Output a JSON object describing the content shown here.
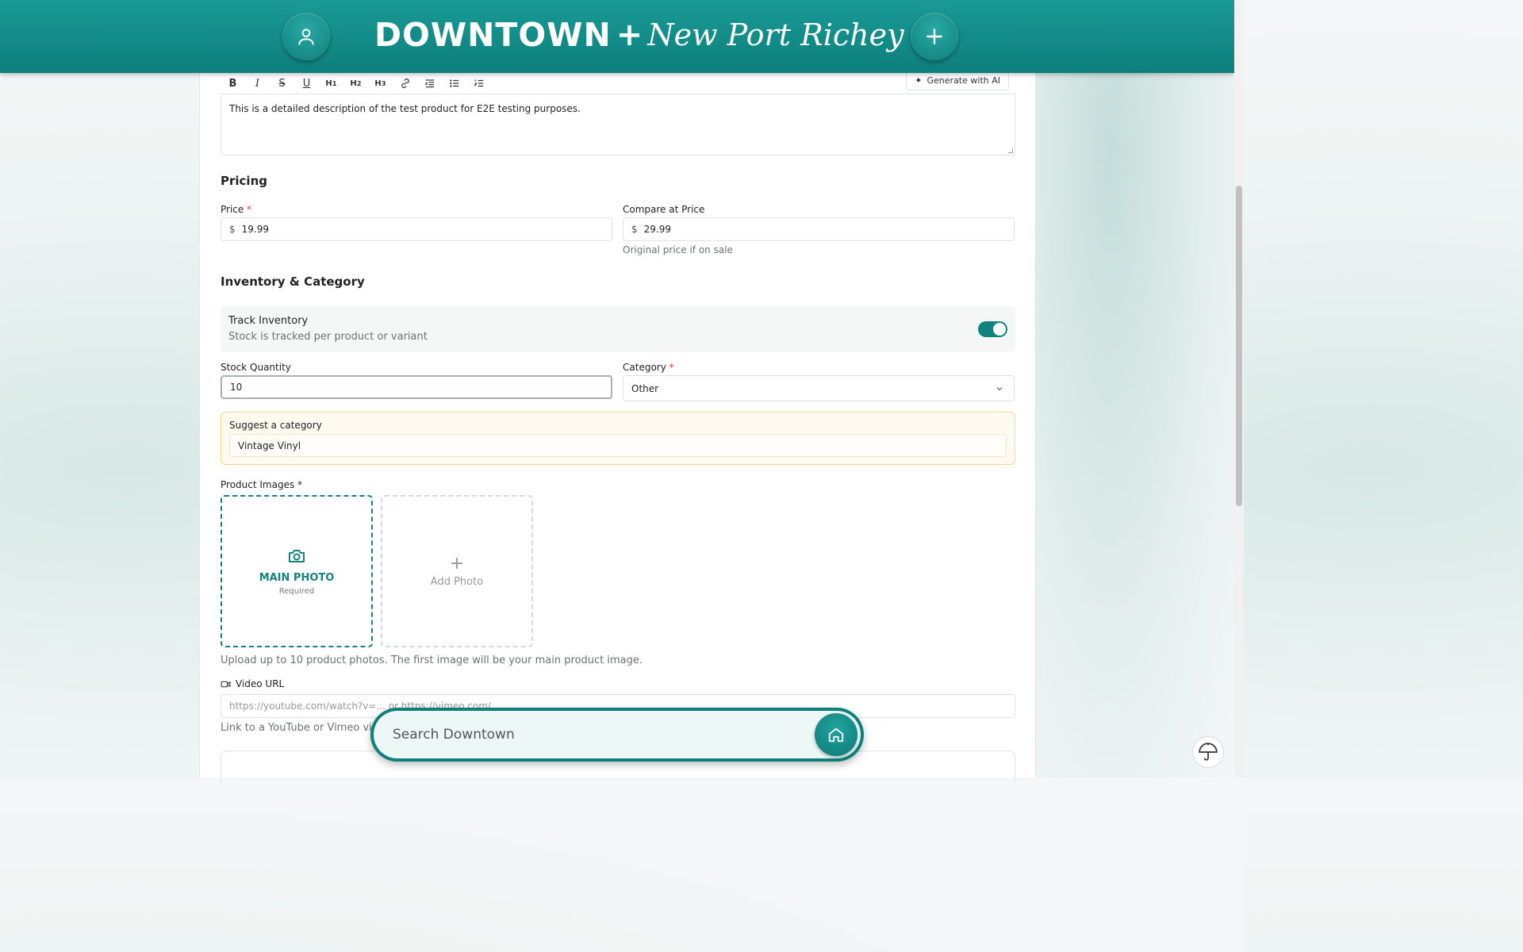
{
  "header": {
    "brand_main": "DOWNTOWN",
    "brand_plus": "+",
    "brand_sub": "New Port Richey",
    "color": "#11837f"
  },
  "editor": {
    "toolbar": [
      "B",
      "I",
      "S",
      "U",
      "H1",
      "H2",
      "H3",
      "link",
      "indent",
      "bullet-list",
      "numbered-list"
    ],
    "ai_button": "Generate with AI",
    "description": "This is a detailed description of the test product for E2E testing purposes."
  },
  "pricing": {
    "title": "Pricing",
    "price_label": "Price",
    "price_required": "*",
    "currency": "$",
    "price_value": "19.99",
    "compare_label": "Compare at Price",
    "compare_value": "29.99",
    "compare_help": "Original price if on sale"
  },
  "inventory": {
    "title": "Inventory & Category",
    "track_label": "Track Inventory",
    "track_sub": "Stock is tracked per product or variant",
    "track_enabled": true,
    "stock_label": "Stock Quantity",
    "stock_value": "10",
    "category_label": "Category",
    "category_required": "*",
    "category_value": "Other",
    "suggest_label": "Suggest a category",
    "suggest_value": "Vintage Vinyl"
  },
  "images": {
    "label": "Product Images *",
    "main_label": "MAIN PHOTO",
    "main_sub": "Required",
    "add_plus": "+",
    "add_label": "Add Photo",
    "help": "Upload up to 10 product photos. The first image will be your main product image."
  },
  "video": {
    "label": "Video URL",
    "placeholder": "https://youtube.com/watch?v=... or https://vimeo.com/...",
    "help": "Link to a YouTube or Vimeo video"
  },
  "search": {
    "placeholder": "Search Downtown"
  }
}
